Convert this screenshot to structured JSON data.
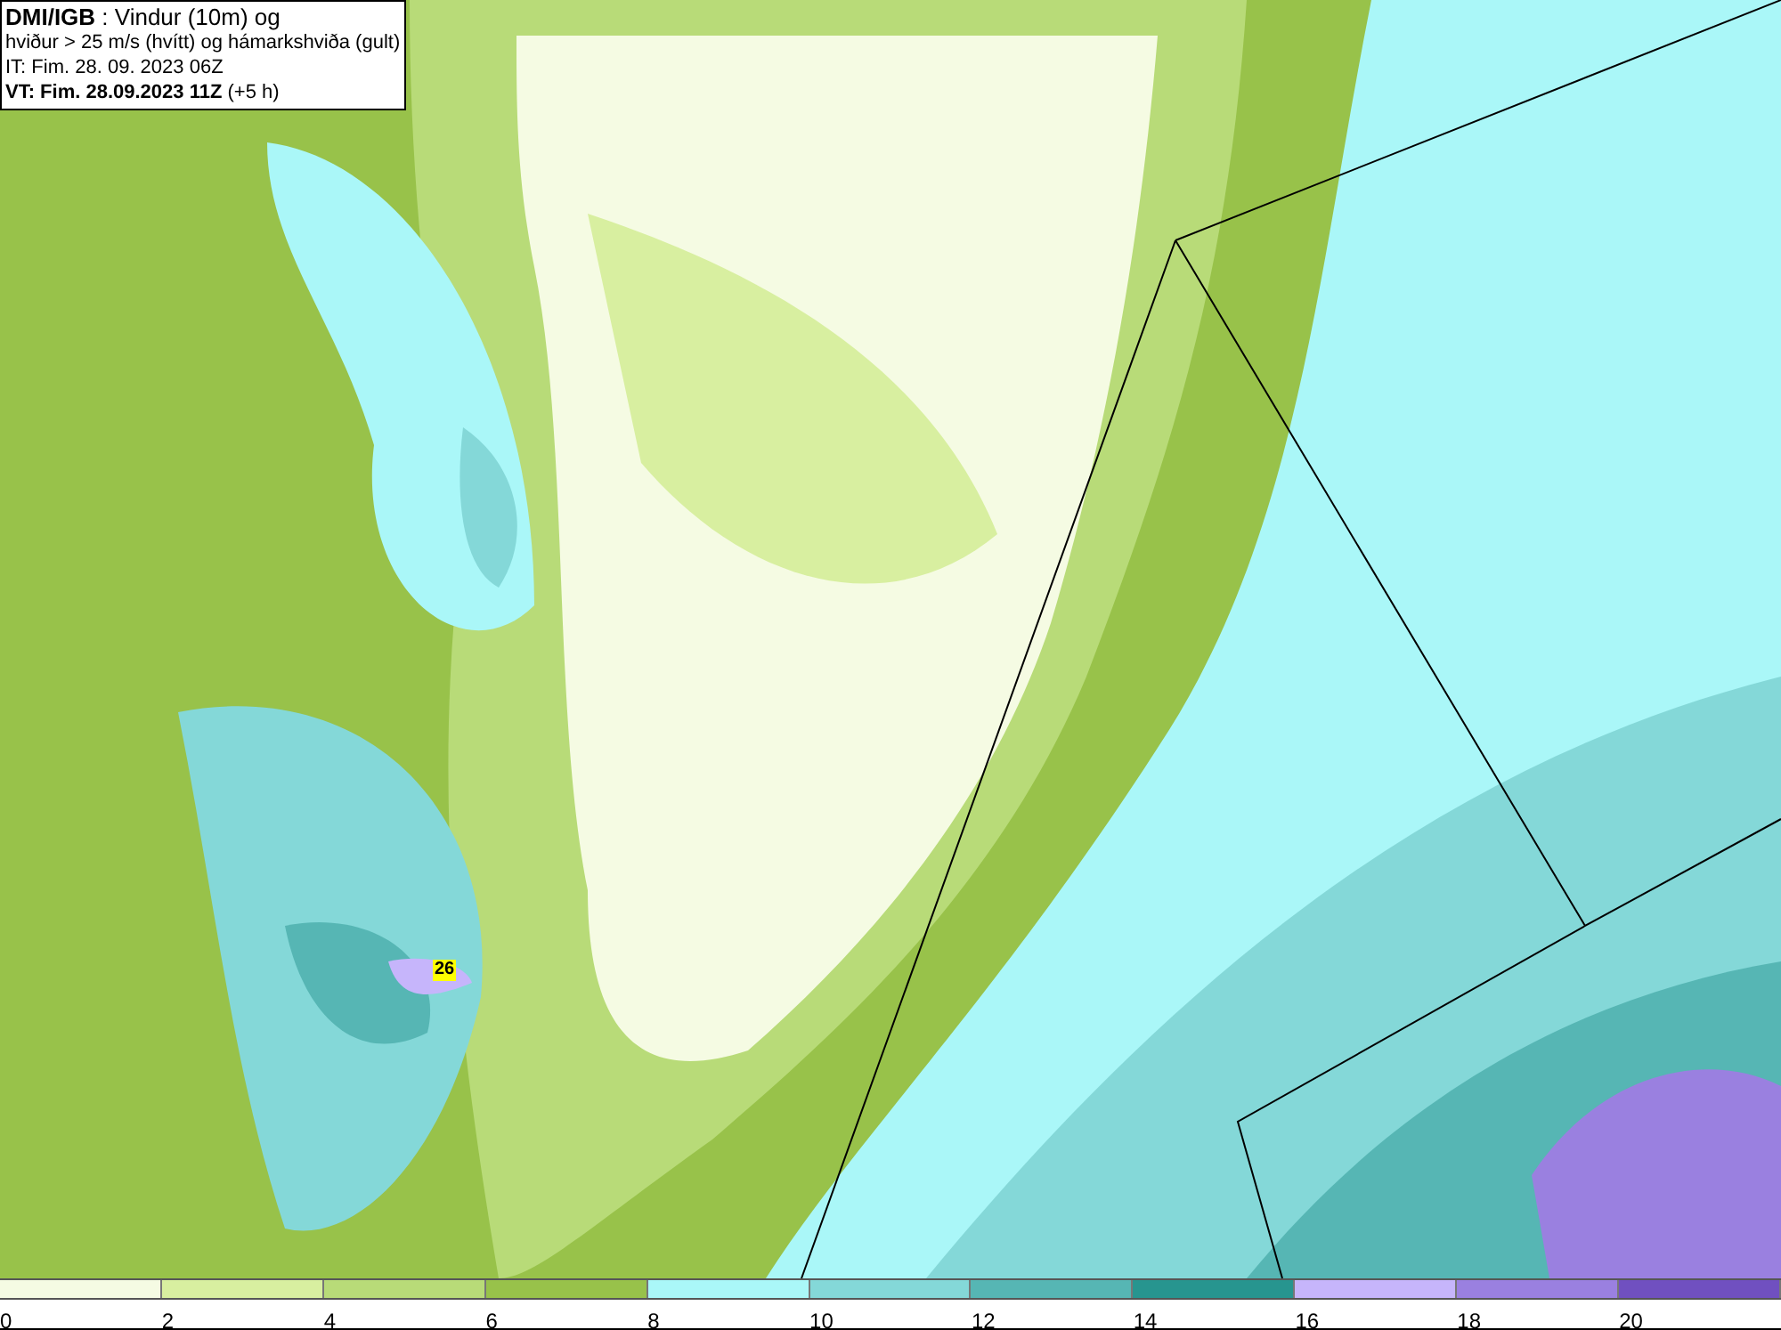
{
  "header": {
    "lines": [
      "**DMI/IGB** : Vindur (10m) og",
      "hviður > 25 m/s (hvítt) og hámarkshviða (gult)",
      "IT: Fim. 28. 09. 2023 06Z",
      "**VT: Fim. 28.09.2023 11Z** (+5 h)"
    ]
  },
  "map": {
    "gust_marker": "26"
  },
  "legend": [
    {
      "color": "#f5fbe3",
      "label": "0"
    },
    {
      "color": "#d8efa0",
      "label": "2"
    },
    {
      "color": "#b8db78",
      "label": "4"
    },
    {
      "color": "#98c24a",
      "label": "6"
    },
    {
      "color": "#aaf7f8",
      "label": "8"
    },
    {
      "color": "#84d8d8",
      "label": "10"
    },
    {
      "color": "#56b6b4",
      "label": "12"
    },
    {
      "color": "#27958f",
      "label": "14"
    },
    {
      "color": "#c6b5fb",
      "label": "16"
    },
    {
      "color": "#9a80e0",
      "label": "18"
    },
    {
      "color": "#7050c0",
      "label": "20"
    }
  ]
}
